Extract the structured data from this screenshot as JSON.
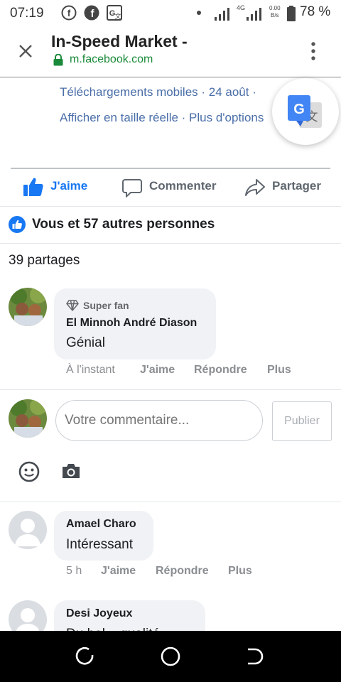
{
  "status_bar": {
    "time": "07:19",
    "network": "4G",
    "speed_value": "0.00",
    "speed_unit": "B/s",
    "battery": "78 %"
  },
  "app_bar": {
    "title": "In-Speed Market -",
    "url": "m.facebook.com"
  },
  "post_meta": {
    "line1": "Téléchargements mobiles · 24 août ·",
    "line2": "Afficher en taille réelle · Plus d'options"
  },
  "actions": {
    "like": "J'aime",
    "comment": "Commenter",
    "share": "Partager"
  },
  "reactions": {
    "summary": "Vous et 57 autres personnes"
  },
  "shares": "39 partages",
  "comments": [
    {
      "badge": "Super fan",
      "author": "El Minnoh André Diason",
      "text": "Génial",
      "time": "À l'instant",
      "like": "J'aime",
      "reply": "Répondre",
      "more": "Plus"
    },
    {
      "author": "Amael Charo",
      "text": "Intéressant",
      "time": "5 h",
      "like": "J'aime",
      "reply": "Répondre",
      "more": "Plus"
    },
    {
      "author": "Desi Joyeux",
      "text": "Du bel... qualité"
    }
  ],
  "composer": {
    "placeholder": "Votre commentaire...",
    "publish": "Publier"
  },
  "icons": {
    "facebook": "facebook-icon",
    "translate": "google-translate-icon",
    "emoji": "emoji-icon",
    "camera": "camera-icon"
  },
  "colors": {
    "facebook_blue": "#1877f2",
    "link_blue": "#4a6ea9",
    "secure_green": "#1a8a3a"
  }
}
